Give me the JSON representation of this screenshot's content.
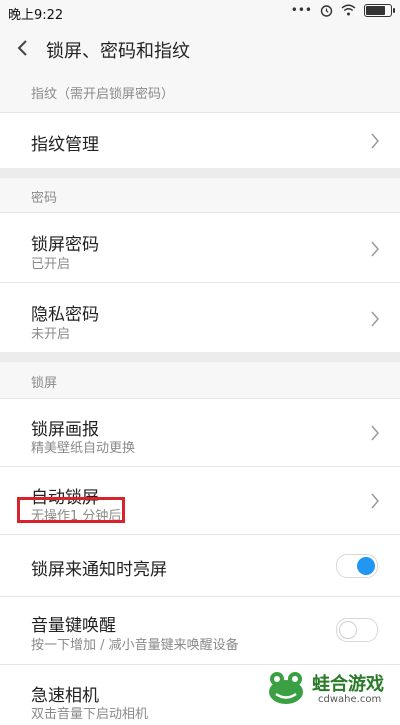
{
  "status": {
    "time": "晚上9:22",
    "dots": "•••",
    "battery_level": 0.85
  },
  "header": {
    "title": "锁屏、密码和指纹"
  },
  "sections": {
    "fingerprint": {
      "label": "指纹（需开启锁屏密码）"
    },
    "password": {
      "label": "密码"
    },
    "lockscreen": {
      "label": "锁屏"
    }
  },
  "rows": {
    "fingerprint_manage": {
      "title": "指纹管理"
    },
    "lock_password": {
      "title": "锁屏密码",
      "subtitle": "已开启"
    },
    "privacy_password": {
      "title": "隐私密码",
      "subtitle": "未开启"
    },
    "lock_wallpaper": {
      "title": "锁屏画报",
      "subtitle": "精美壁纸自动更换"
    },
    "auto_lock": {
      "title": "自动锁屏",
      "subtitle": "无操作1 分钟后"
    },
    "notify_wake": {
      "title": "锁屏来通知时亮屏",
      "enabled": true
    },
    "volume_wake": {
      "title": "音量键唤醒",
      "subtitle": "按一下增加 / 减小音量键来唤醒设备",
      "enabled": false
    },
    "quick_camera": {
      "title": "急速相机",
      "subtitle": "双击音量下启动相机"
    }
  },
  "colors": {
    "accent": "#2196f3",
    "highlight": "#d9232c",
    "brand_green": "#2a7a2a"
  },
  "watermark": {
    "name": "蛙合游戏",
    "url": "cdwahe.com"
  }
}
